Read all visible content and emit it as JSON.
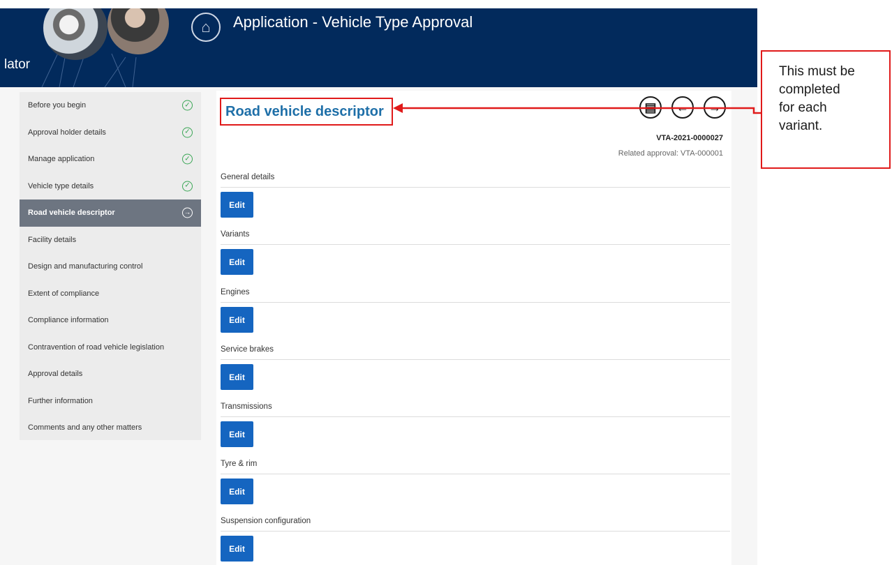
{
  "header": {
    "cut_text": "lator",
    "app_title": "Application - Vehicle Type Approval",
    "home_icon": "home-icon",
    "background": "#022a5c"
  },
  "sidebar": {
    "items": [
      {
        "label": "Before you begin",
        "status": "complete"
      },
      {
        "label": "Approval holder details",
        "status": "complete"
      },
      {
        "label": "Manage application",
        "status": "complete"
      },
      {
        "label": "Vehicle type details",
        "status": "complete"
      },
      {
        "label": "Road vehicle descriptor",
        "status": "current"
      },
      {
        "label": "Facility details",
        "status": "none"
      },
      {
        "label": "Design and manufacturing control",
        "status": "none"
      },
      {
        "label": "Extent of compliance",
        "status": "none"
      },
      {
        "label": "Compliance information",
        "status": "none"
      },
      {
        "label": "Contravention of road vehicle legislation",
        "status": "none"
      },
      {
        "label": "Approval details",
        "status": "none"
      },
      {
        "label": "Further information",
        "status": "none"
      },
      {
        "label": "Comments and any other matters",
        "status": "none"
      }
    ]
  },
  "main": {
    "page_title": "Road vehicle descriptor",
    "reference": "VTA-2021-0000027",
    "related_approval": "Related approval: VTA-000001",
    "toolbar_icons": [
      "document-icon",
      "previous-arrow-icon",
      "next-arrow-icon"
    ],
    "sections": [
      {
        "label": "General details",
        "button": "Edit"
      },
      {
        "label": "Variants",
        "button": "Edit"
      },
      {
        "label": "Engines",
        "button": "Edit"
      },
      {
        "label": "Service brakes",
        "button": "Edit"
      },
      {
        "label": "Transmissions",
        "button": "Edit"
      },
      {
        "label": "Tyre & rim",
        "button": "Edit"
      },
      {
        "label": "Suspension configuration",
        "button": "Edit"
      }
    ]
  },
  "annotation": {
    "lines": [
      "This must be",
      "completed",
      "for each",
      "variant."
    ],
    "color": "#e01a1a"
  },
  "colors": {
    "accent_button": "#1565c0",
    "title": "#1e6fa8",
    "complete_icon": "#3aa655",
    "active_nav": "#6d7581"
  }
}
